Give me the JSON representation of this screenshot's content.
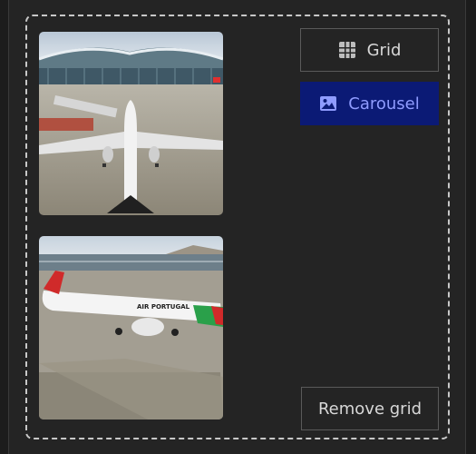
{
  "buttons": {
    "grid_label": "Grid",
    "carousel_label": "Carousel",
    "remove_grid_label": "Remove grid"
  },
  "images": [
    {
      "icon": "airplane-photo",
      "airline_text": ""
    },
    {
      "icon": "airplane-photo",
      "airline_text": "AIR PORTUGAL"
    }
  ],
  "colors": {
    "background": "#242424",
    "carousel_active_bg": "#0b1a75",
    "carousel_active_text": "#8f9cff",
    "border": "#c8c8c8"
  }
}
